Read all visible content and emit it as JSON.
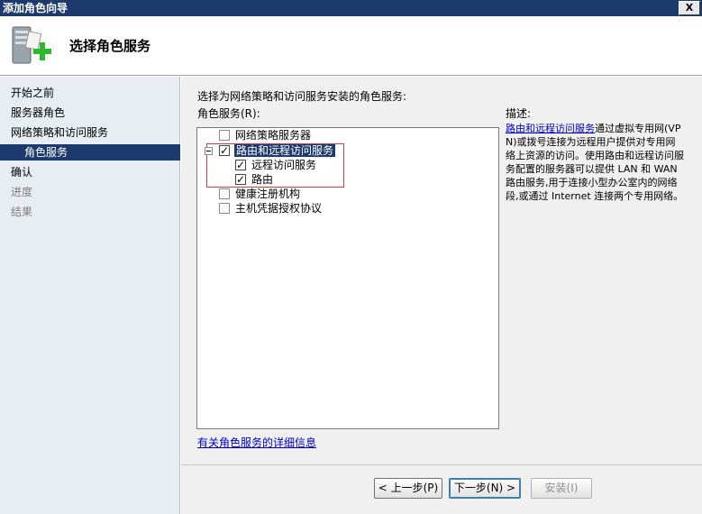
{
  "window": {
    "title": "添加角色向导",
    "close_label": "X"
  },
  "header": {
    "title": "选择角色服务",
    "icon": "server-add-icon"
  },
  "nav": {
    "items": [
      {
        "label": "开始之前",
        "state": "normal"
      },
      {
        "label": "服务器角色",
        "state": "normal"
      },
      {
        "label": "网络策略和访问服务",
        "state": "normal"
      },
      {
        "label": "角色服务",
        "state": "selected"
      },
      {
        "label": "确认",
        "state": "normal"
      },
      {
        "label": "进度",
        "state": "disabled"
      },
      {
        "label": "结果",
        "state": "disabled"
      }
    ]
  },
  "main": {
    "intro": "选择为网络策略和访问服务安装的角色服务:",
    "role_services_label": "角色服务(R):",
    "tree": [
      {
        "label": "网络策略服务器",
        "checked": false,
        "level": 0
      },
      {
        "label": "路由和远程访问服务",
        "checked": true,
        "level": 0,
        "expanded": true,
        "selected": true
      },
      {
        "label": "远程访问服务",
        "checked": true,
        "level": 1
      },
      {
        "label": "路由",
        "checked": true,
        "level": 1
      },
      {
        "label": "健康注册机构",
        "checked": false,
        "level": 0
      },
      {
        "label": "主机凭据授权协议",
        "checked": false,
        "level": 0
      }
    ],
    "description_label": "描述:",
    "description_link": "路由和远程访问服务",
    "description_text": "通过虚拟专用网(VPN)或拨号连接为远程用户提供对专用网络上资源的访问。使用路由和远程访问服务配置的服务器可以提供 LAN 和 WAN 路由服务,用于连接小型办公室内的网络段,或通过 Internet 连接两个专用网络。",
    "more_info_link": "有关角色服务的详细信息"
  },
  "footer": {
    "back_label": "< 上一步(P)",
    "next_label": "下一步(N) >",
    "install_label": "安装(I)"
  }
}
